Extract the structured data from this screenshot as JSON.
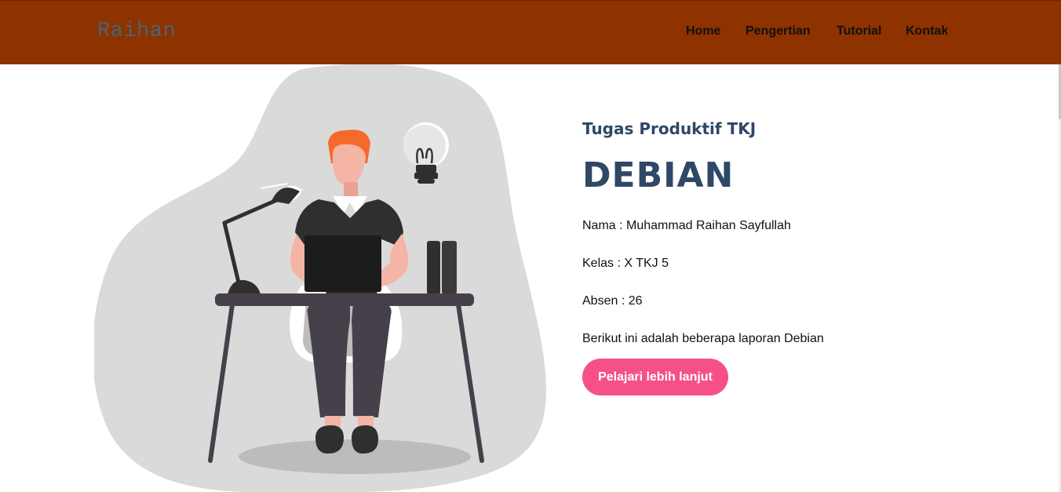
{
  "navbar": {
    "brand": "Raihan",
    "links": [
      "Home",
      "Pengertian",
      "Tutorial",
      "Kontak"
    ]
  },
  "hero": {
    "subtitle": "Tugas Produktif TKJ",
    "title": "DEBIAN",
    "info": [
      "Nama : Muhammad Raihan Sayfullah",
      "Kelas : X TKJ 5",
      "Absen : 26",
      "Berikut ini adalah beberapa laporan Debian"
    ],
    "button_label": "Pelajari lebih lanjut"
  },
  "colors": {
    "navbar_bg": "#8e3200",
    "brand": "#4a6472",
    "heading": "#2e4866",
    "button": "#f5508a"
  },
  "icons": {
    "illustration": "person-at-desk-with-laptop-lamp-lightbulb-books"
  }
}
